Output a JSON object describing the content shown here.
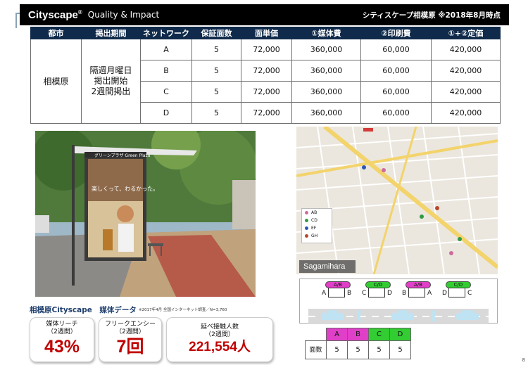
{
  "header": {
    "brand": "Cityscape",
    "brand_mark": "®",
    "tagline": "Quality & Impact",
    "right_title": "シティスケープ相模原 ※2018年8月時点"
  },
  "rate_table": {
    "columns": [
      "都市",
      "掲出期間",
      "ネットワーク",
      "保証面数",
      "面単価",
      "①媒体費",
      "②印刷費",
      "①+②定価"
    ],
    "city": "相模原",
    "period_lines": [
      "隔週月曜日",
      "掲出開始",
      "2週間掲出"
    ],
    "rows": [
      {
        "network": "A",
        "faces": "5",
        "unit_price": "72,000",
        "media_fee": "360,000",
        "print_fee": "60,000",
        "total": "420,000"
      },
      {
        "network": "B",
        "faces": "5",
        "unit_price": "72,000",
        "media_fee": "360,000",
        "print_fee": "60,000",
        "total": "420,000"
      },
      {
        "network": "C",
        "faces": "5",
        "unit_price": "72,000",
        "media_fee": "360,000",
        "print_fee": "60,000",
        "total": "420,000"
      },
      {
        "network": "D",
        "faces": "5",
        "unit_price": "72,000",
        "media_fee": "360,000",
        "print_fee": "60,000",
        "total": "420,000"
      }
    ]
  },
  "photo": {
    "shelter_sign": "グリーンプラザ Green Plaza",
    "ad_copy": "楽しくって、わるかった。"
  },
  "map": {
    "label": "Sagamihara",
    "legend": [
      {
        "label": "AB",
        "color": "#d06a9e"
      },
      {
        "label": "CD",
        "color": "#2e9a45"
      },
      {
        "label": "EF",
        "color": "#2c55b5"
      },
      {
        "label": "GH",
        "color": "#b5492c"
      }
    ]
  },
  "diagram": {
    "pills": [
      {
        "label": "A/B",
        "color": "#e040c8"
      },
      {
        "label": "C/D",
        "color": "#33cc33"
      },
      {
        "label": "A/B",
        "color": "#e040c8"
      },
      {
        "label": "C/D",
        "color": "#33cc33"
      }
    ],
    "panels": [
      {
        "left": "A",
        "right": "B"
      },
      {
        "left": "C",
        "right": "D"
      },
      {
        "left": "B",
        "right": "A"
      },
      {
        "left": "D",
        "right": "C"
      }
    ]
  },
  "face_table": {
    "row_label": "面数",
    "headers": [
      {
        "label": "A",
        "color": "#e040c8"
      },
      {
        "label": "B",
        "color": "#e040c8"
      },
      {
        "label": "C",
        "color": "#33cc33"
      },
      {
        "label": "D",
        "color": "#33cc33"
      }
    ],
    "values": [
      "5",
      "5",
      "5",
      "5"
    ]
  },
  "stats": {
    "title": "相模原Cityscape　媒体データ",
    "note": "※2017年4月 全国インターネット調査／N=3,760",
    "cards": [
      {
        "label1": "媒体リーチ",
        "label2": "（2週間）",
        "value": "43%"
      },
      {
        "label1": "フリークエンシー",
        "label2": "（2週間）",
        "value": "7回"
      },
      {
        "label1": "延べ接触人数",
        "label2": "（2週間）",
        "value": "221,554人"
      }
    ]
  },
  "page_number": "8"
}
